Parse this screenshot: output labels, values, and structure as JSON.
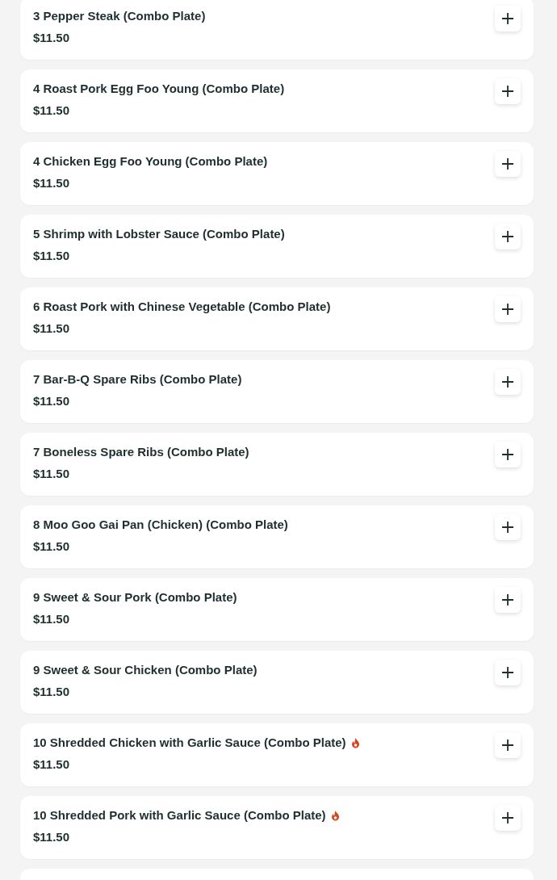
{
  "menu_items": [
    {
      "name": "3 Pepper Steak (Combo Plate)",
      "price": "$11.50",
      "spicy": false
    },
    {
      "name": "4 Roast Pork Egg Foo Young (Combo Plate)",
      "price": "$11.50",
      "spicy": false
    },
    {
      "name": "4 Chicken Egg Foo Young (Combo Plate)",
      "price": "$11.50",
      "spicy": false
    },
    {
      "name": "5 Shrimp with Lobster Sauce (Combo Plate)",
      "price": "$11.50",
      "spicy": false
    },
    {
      "name": "6 Roast Pork with Chinese Vegetable (Combo Plate)",
      "price": "$11.50",
      "spicy": false
    },
    {
      "name": "7 Bar-B-Q Spare Ribs (Combo Plate)",
      "price": "$11.50",
      "spicy": false
    },
    {
      "name": "7 Boneless Spare Ribs (Combo Plate)",
      "price": "$11.50",
      "spicy": false
    },
    {
      "name": "8 Moo Goo Gai Pan (Chicken) (Combo Plate)",
      "price": "$11.50",
      "spicy": false
    },
    {
      "name": "9 Sweet & Sour Pork (Combo Plate)",
      "price": "$11.50",
      "spicy": false
    },
    {
      "name": "9 Sweet & Sour Chicken (Combo Plate)",
      "price": "$11.50",
      "spicy": false
    },
    {
      "name": "10 Shredded Chicken with Garlic Sauce (Combo Plate)",
      "price": "$11.50",
      "spicy": true
    },
    {
      "name": "10 Shredded Pork with Garlic Sauce (Combo Plate)",
      "price": "$11.50",
      "spicy": true
    }
  ]
}
